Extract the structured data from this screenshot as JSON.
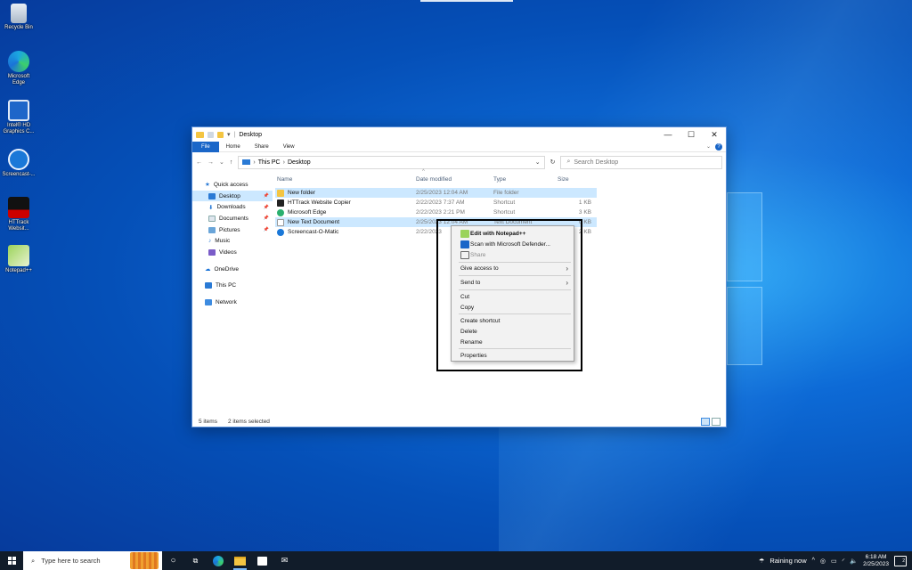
{
  "desktop": {
    "icons": [
      {
        "label": "Recycle Bin",
        "icon": "recycle-bin-icon"
      },
      {
        "label": "Microsoft Edge",
        "icon": "edge-icon"
      },
      {
        "label": "Intel® HD Graphics C...",
        "icon": "intel-graphics-icon"
      },
      {
        "label": "Screencast-...",
        "icon": "screencast-icon"
      },
      {
        "label": "HTTrack Websit...",
        "icon": "httrack-icon"
      },
      {
        "label": "Notepad++",
        "icon": "notepadpp-icon"
      }
    ]
  },
  "window": {
    "title": "Desktop",
    "ribbon_tabs": [
      "File",
      "Home",
      "Share",
      "View"
    ],
    "breadcrumb": [
      "This PC",
      "Desktop"
    ],
    "search_placeholder": "Search Desktop",
    "columns": {
      "name": "Name",
      "date": "Date modified",
      "type": "Type",
      "size": "Size"
    },
    "sidebar": {
      "quick_access": "Quick access",
      "items": [
        "Desktop",
        "Downloads",
        "Documents",
        "Pictures",
        "Music",
        "Videos"
      ],
      "onedrive": "OneDrive",
      "thispc": "This PC",
      "network": "Network"
    },
    "files": [
      {
        "name": "New folder",
        "date": "2/25/2023 12:04 AM",
        "type": "File folder",
        "size": ""
      },
      {
        "name": "HTTrack Website Copier",
        "date": "2/22/2023 7:37 AM",
        "type": "Shortcut",
        "size": "1 KB"
      },
      {
        "name": "Microsoft Edge",
        "date": "2/22/2023 2:21 PM",
        "type": "Shortcut",
        "size": "3 KB"
      },
      {
        "name": "New Text Document",
        "date": "2/25/2023 12:04 AM",
        "type": "Text Document",
        "size": "0 KB"
      },
      {
        "name": "Screencast-O-Matic",
        "date": "2/22/2023",
        "type": "",
        "size": "2 KB"
      }
    ],
    "status": {
      "items": "5 items",
      "selected": "2 items selected"
    }
  },
  "context_menu": {
    "edit_notepad": "Edit with Notepad++",
    "scan_defender": "Scan with Microsoft Defender...",
    "share": "Share",
    "give_access": "Give access to",
    "send_to": "Send to",
    "cut": "Cut",
    "copy": "Copy",
    "create_shortcut": "Create shortcut",
    "delete": "Delete",
    "rename": "Rename",
    "properties": "Properties"
  },
  "taskbar": {
    "search_placeholder": "Type here to search",
    "weather": "Raining now",
    "time": "6:18 AM",
    "date": "2/25/2023",
    "notification_count": "2"
  }
}
